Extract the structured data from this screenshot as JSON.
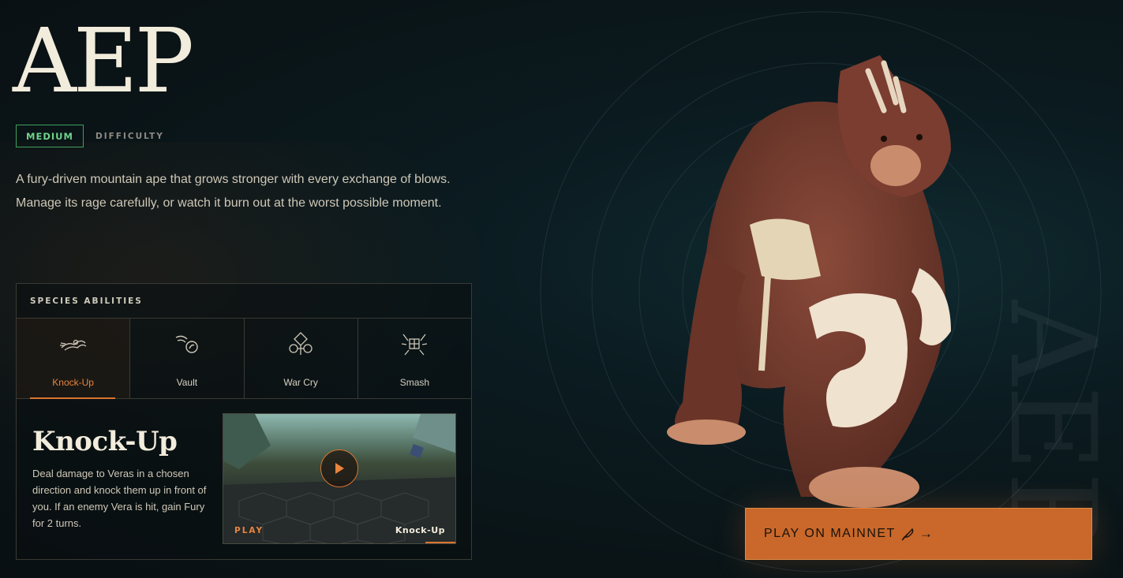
{
  "hero": {
    "title": "AEP",
    "difficulty_level": "MEDIUM",
    "difficulty_label": "DIFFICULTY",
    "description": "A fury-driven mountain ape that grows stronger with every exchange of blows. Manage its rage carefully, or watch it burn out at the worst possible moment."
  },
  "abilities": {
    "header": "SPECIES ABILITIES",
    "tabs": [
      {
        "label": "Knock-Up",
        "icon": "knock-up-icon",
        "active": true
      },
      {
        "label": "Vault",
        "icon": "vault-icon",
        "active": false
      },
      {
        "label": "War Cry",
        "icon": "war-cry-icon",
        "active": false
      },
      {
        "label": "Smash",
        "icon": "smash-icon",
        "active": false
      }
    ],
    "selected": {
      "name": "Knock-Up",
      "description": "Deal damage to Veras in a chosen direction and knock them up in front of you. If an enemy Vera is hit, gain Fury for 2 turns.",
      "video_play_label": "PLAY",
      "video_name_label": "Knock-Up"
    }
  },
  "watermark": "AEP",
  "cta": {
    "label": "PLAY ON MAINNET",
    "icon": "feather-icon",
    "arrow": "→"
  },
  "colors": {
    "accent": "#c9682a",
    "badge_green": "#3fa15d",
    "background": "#0a1417"
  }
}
